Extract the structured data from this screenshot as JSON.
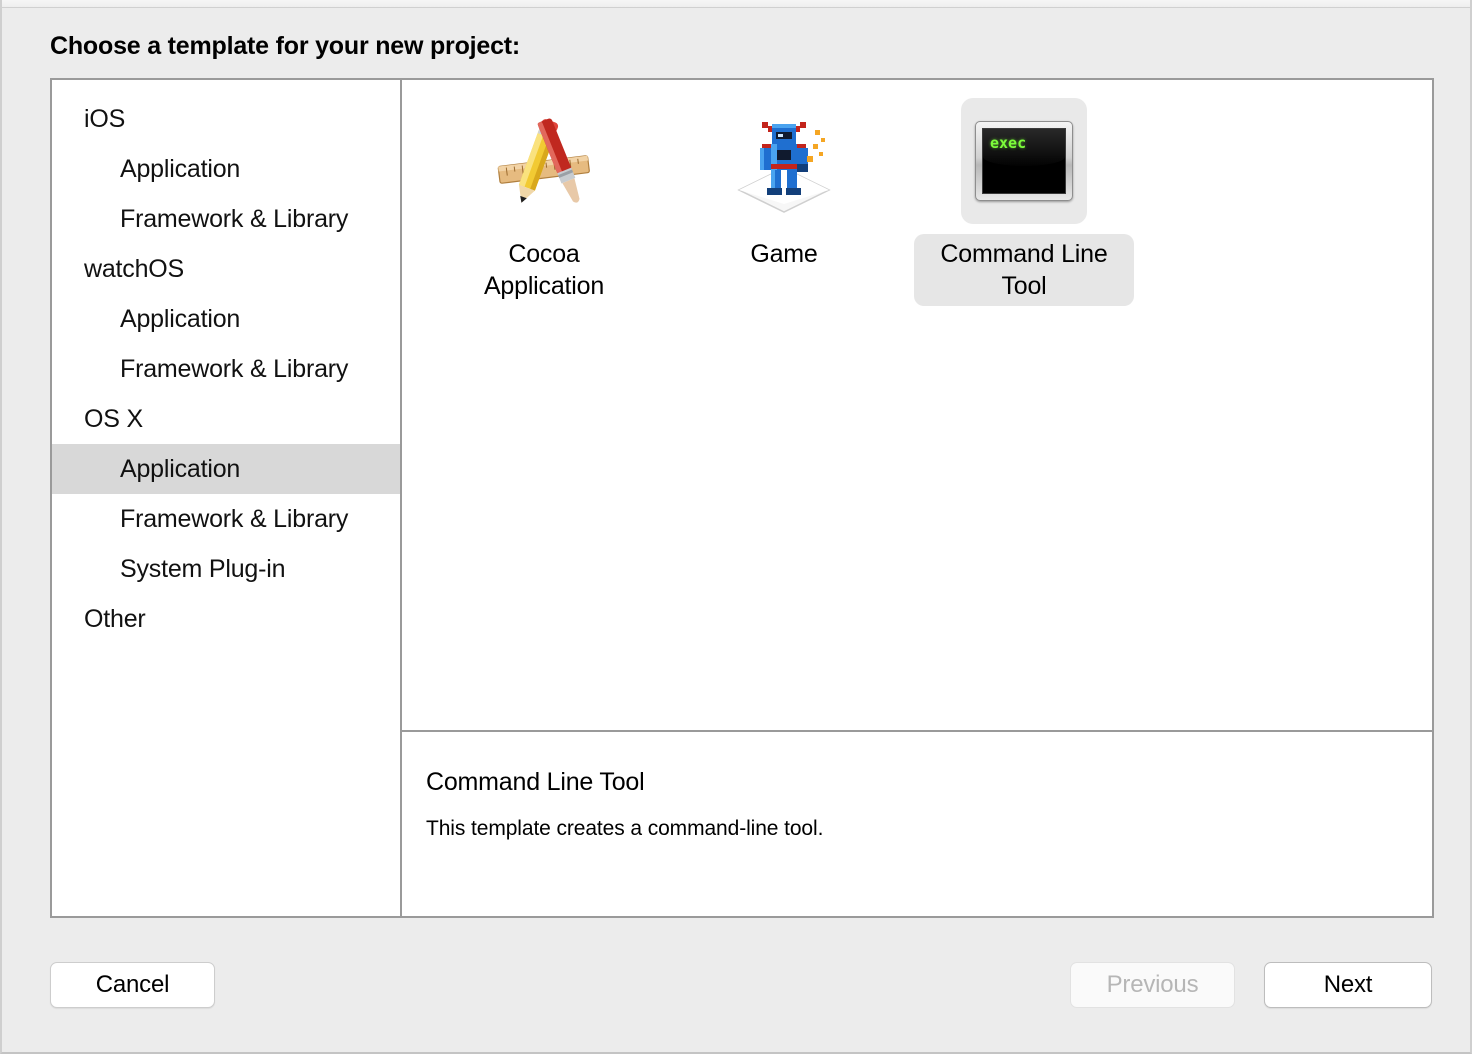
{
  "dialog": {
    "prompt": "Choose a template for your new project:"
  },
  "sidebar": {
    "items": [
      {
        "label": "iOS",
        "level": "group",
        "selected": false
      },
      {
        "label": "Application",
        "level": "child",
        "selected": false
      },
      {
        "label": "Framework & Library",
        "level": "child",
        "selected": false
      },
      {
        "label": "watchOS",
        "level": "group",
        "selected": false
      },
      {
        "label": "Application",
        "level": "child",
        "selected": false
      },
      {
        "label": "Framework & Library",
        "level": "child",
        "selected": false
      },
      {
        "label": "OS X",
        "level": "group",
        "selected": false
      },
      {
        "label": "Application",
        "level": "child",
        "selected": true
      },
      {
        "label": "Framework & Library",
        "level": "child",
        "selected": false
      },
      {
        "label": "System Plug-in",
        "level": "child",
        "selected": false
      },
      {
        "label": "Other",
        "level": "group",
        "selected": false
      }
    ]
  },
  "templates": [
    {
      "label": "Cocoa\nApplication",
      "icon": "xcode-hammer-icon",
      "selected": false
    },
    {
      "label": "Game",
      "icon": "game-robot-icon",
      "selected": false
    },
    {
      "label": "Command Line Tool",
      "icon": "terminal-exec-icon",
      "selected": true
    }
  ],
  "terminal_icon": {
    "screen_text": "exec"
  },
  "description": {
    "title": "Command Line Tool",
    "text": "This template creates a command-line tool."
  },
  "footer": {
    "cancel_label": "Cancel",
    "previous_label": "Previous",
    "next_label": "Next"
  },
  "colors": {
    "window_background": "#ececec",
    "panel_border": "#9a9a9a",
    "selection_gray": "#d8d8d8",
    "terminal_green": "#7cfc3a",
    "disabled_text": "#b6b6b6"
  }
}
